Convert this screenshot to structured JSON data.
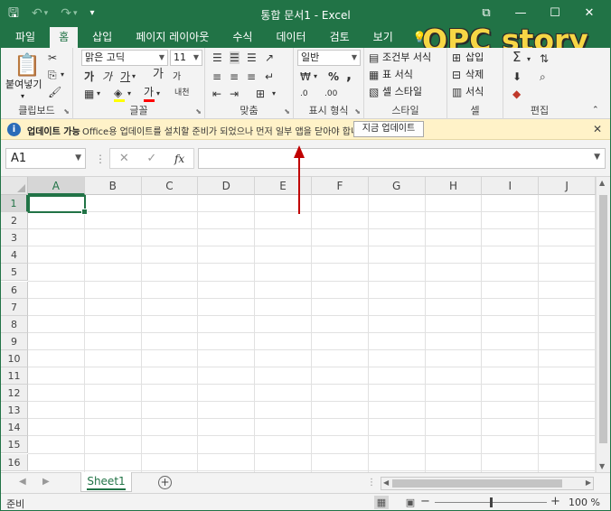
{
  "window": {
    "title": "통합 문서1 - Excel",
    "controls": {
      "restore": "⧉",
      "minimize": "—",
      "maximize": "☐",
      "close": "✕"
    }
  },
  "qat": {
    "save": "🖫",
    "undo": "↶",
    "undo_drop": "▾",
    "redo": "↷",
    "redo_drop": "▾",
    "customize": "▾"
  },
  "tabs": [
    {
      "label": "파일",
      "active": false
    },
    {
      "label": "홈",
      "active": true
    },
    {
      "label": "삽입",
      "active": false
    },
    {
      "label": "페이지 레이아웃",
      "active": false
    },
    {
      "label": "수식",
      "active": false
    },
    {
      "label": "데이터",
      "active": false
    },
    {
      "label": "검토",
      "active": false
    },
    {
      "label": "보기",
      "active": false
    }
  ],
  "tell_me_icon": "💡",
  "watermark": "OPC story",
  "ribbon": {
    "clipboard": {
      "label": "클립보드",
      "paste": "붙여넣기",
      "paste_drop": "▾",
      "cut": "✂",
      "copy": "⎘",
      "copy_drop": "▾",
      "painter": "🖌"
    },
    "font": {
      "label": "글꼴",
      "name": "맑은 고딕",
      "size": "11",
      "bold": "가",
      "italic": "가",
      "underline": "가",
      "grow": "가",
      "shrink": "가",
      "border": "▦",
      "fill": "◈",
      "fontcolor": "가",
      "phonetic": "내천",
      "fill_color": "#ffff00",
      "font_color": "#ff0000"
    },
    "align": {
      "label": "맞춤"
    },
    "number": {
      "label": "표시 형식",
      "format": "일반",
      "currency": "₩",
      "percent": "%",
      "comma": ",",
      "inc_dec": ".0",
      "dec_dec": ".00"
    },
    "styles": {
      "label": "스타일",
      "conditional": "조건부 서식",
      "table": "표 서식",
      "cell": "셀 스타일"
    },
    "cells": {
      "label": "셀",
      "insert": "삽입",
      "delete": "삭제",
      "format": "서식"
    },
    "editing": {
      "label": "편집",
      "sum": "Σ",
      "fill": "⬇",
      "clear": "◆",
      "sort": "⇅",
      "find": "⌕"
    }
  },
  "infobar": {
    "title": "업데이트 가능",
    "message": "Office용 업데이트를 설치할 준비가 되었으나 먼저 일부 앱을 닫아야 합니다.",
    "button": "지금 업데이트",
    "close": "✕",
    "icon": "i"
  },
  "formula_bar": {
    "name_box": "A1",
    "cancel": "✕",
    "enter": "✓",
    "fx": "fx",
    "value": ""
  },
  "grid": {
    "columns": [
      "A",
      "B",
      "C",
      "D",
      "E",
      "F",
      "G",
      "H",
      "I",
      "J"
    ],
    "rows": [
      "1",
      "2",
      "3",
      "4",
      "5",
      "6",
      "7",
      "8",
      "9",
      "10",
      "11",
      "12",
      "13",
      "14",
      "15",
      "16"
    ],
    "active_cell": "A1"
  },
  "sheets": [
    {
      "name": "Sheet1",
      "active": true
    }
  ],
  "add_sheet": "+",
  "status": {
    "text": "준비",
    "zoom": "100 %",
    "zoom_level": 100,
    "minus": "−",
    "plus": "+"
  },
  "accent_color": "#217346",
  "arrow_color": "#c00000"
}
